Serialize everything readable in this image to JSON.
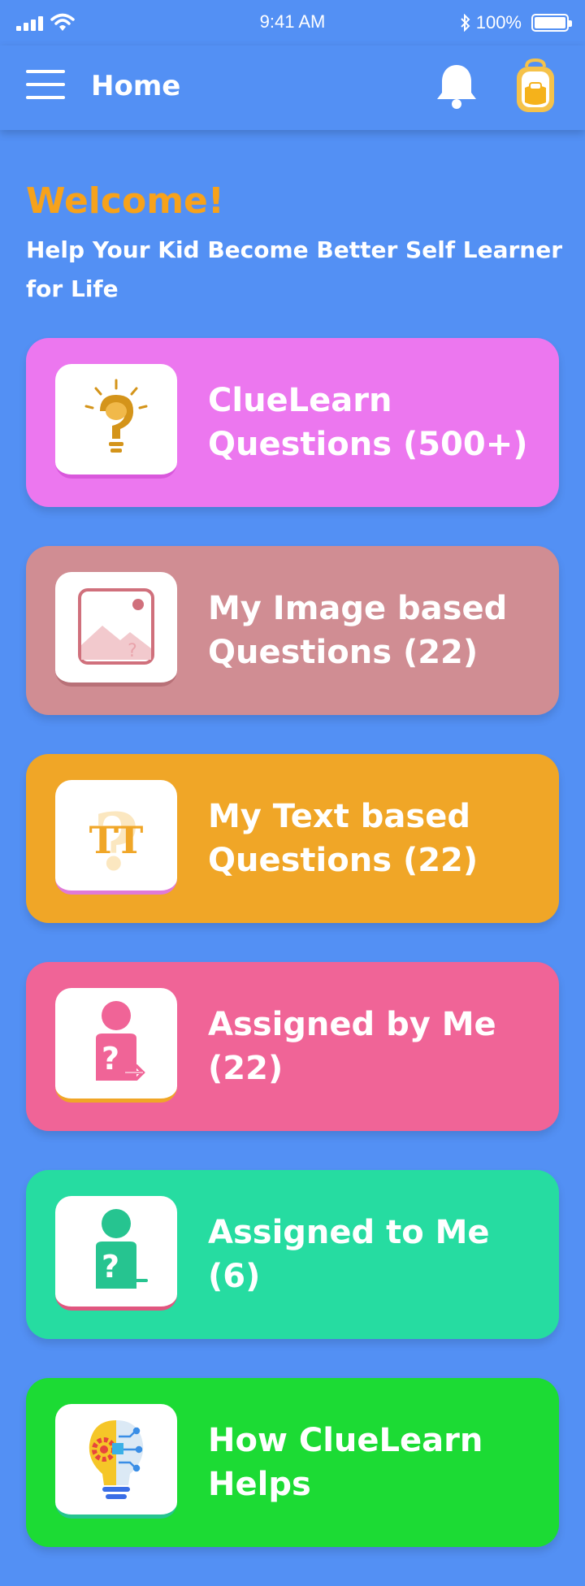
{
  "status_bar": {
    "time": "9:41 AM",
    "battery": "100%"
  },
  "nav": {
    "title": "Home"
  },
  "welcome": {
    "heading": "Welcome!",
    "subtitle": "Help Your Kid Become Better Self Learner for Life"
  },
  "cards": [
    {
      "label": "ClueLearn Questions (500+)",
      "icon": "lightbulb-brain-icon",
      "color": "#ec77ef"
    },
    {
      "label": "My Image based Questions (22)",
      "icon": "image-question-icon",
      "color": "#d08d93"
    },
    {
      "label": "My Text based Questions (22)",
      "icon": "text-question-icon",
      "color": "#f0a627"
    },
    {
      "label": "Assigned by Me (22)",
      "icon": "person-question-out-icon",
      "color": "#f06497"
    },
    {
      "label": "Assigned to Me (6)",
      "icon": "person-question-in-icon",
      "color": "#26dca1"
    },
    {
      "label": "How ClueLearn Helps",
      "icon": "idea-bulb-icon",
      "color": "#1cdb34"
    }
  ],
  "colors": {
    "background": "#5390f4",
    "accent": "#f7a21b"
  }
}
